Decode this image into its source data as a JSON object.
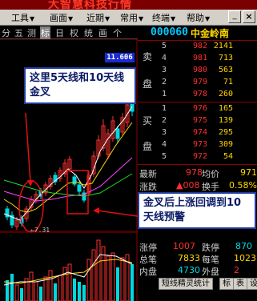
{
  "app": {
    "title": "大智慧科技行情"
  },
  "menu": {
    "items": [
      "工具",
      "画面",
      "近期",
      "常用",
      "终端",
      "帮助"
    ]
  },
  "toolbar": {
    "items": [
      "分",
      "五",
      "测",
      "标",
      "日",
      "权",
      "统",
      "画",
      "个"
    ],
    "selected": "标"
  },
  "stock": {
    "code": "000060",
    "name": "中金岭南"
  },
  "chart": {
    "current_price_label": "11.606",
    "low_label": "←7.31"
  },
  "orderbook": {
    "sell_label": [
      "卖",
      "盘"
    ],
    "buy_label": [
      "买",
      "盘"
    ],
    "sell": [
      {
        "level": "5",
        "price": "982",
        "volume": "2141",
        "color": "#ff3030"
      },
      {
        "level": "4",
        "price": "981",
        "volume": "713",
        "color": "#ff3030"
      },
      {
        "level": "3",
        "price": "980",
        "volume": "563",
        "color": "#ff3030"
      },
      {
        "level": "2",
        "price": "979",
        "volume": "71",
        "color": "#ff3030"
      },
      {
        "level": "1",
        "price": "978",
        "volume": "260",
        "color": "#ff3030"
      }
    ],
    "buy": [
      {
        "level": "1",
        "price": "976",
        "volume": "165",
        "color": "#ff3030"
      },
      {
        "level": "2",
        "price": "975",
        "volume": "139",
        "color": "#ff3030"
      },
      {
        "level": "3",
        "price": "974",
        "volume": "295",
        "color": "#ff3030"
      },
      {
        "level": "4",
        "price": "973",
        "volume": "309",
        "color": "#ff3030"
      },
      {
        "level": "5",
        "price": "972",
        "volume": "54",
        "color": "#ff3030"
      }
    ]
  },
  "quote": {
    "latest_label": "最新",
    "latest_value": "978",
    "avg_label": "均价",
    "avg_value": "971",
    "change_label": "涨跌",
    "change_value": "▲008",
    "turnover_label": "换手",
    "turnover_value": "0.58%"
  },
  "stats": [
    {
      "l1": "涨停",
      "v1": "1007",
      "l2": "跌停",
      "v2": "870"
    },
    {
      "l1": "总笔",
      "v1": "7833",
      "l2": "每笔",
      "v2": "1023"
    },
    {
      "l1": "内盘",
      "v1": "4730",
      "l2": "外盘",
      "v2": "2"
    }
  ],
  "tabs": {
    "items": [
      "短线精灵统计",
      "标",
      "表",
      "设"
    ]
  },
  "annotations": {
    "top": "这里5天线和10天线金叉",
    "bottom": "金叉后上涨回调到10天线预警"
  },
  "colors": {
    "up": "#ff3030",
    "down": "#00d8e0",
    "ma5": "#ffffff",
    "ma10": "#ffd600",
    "ma20": "#ff44ff",
    "ma30": "#22dd22",
    "accent": "#1e3ca0",
    "brand": "#7a0000"
  }
}
